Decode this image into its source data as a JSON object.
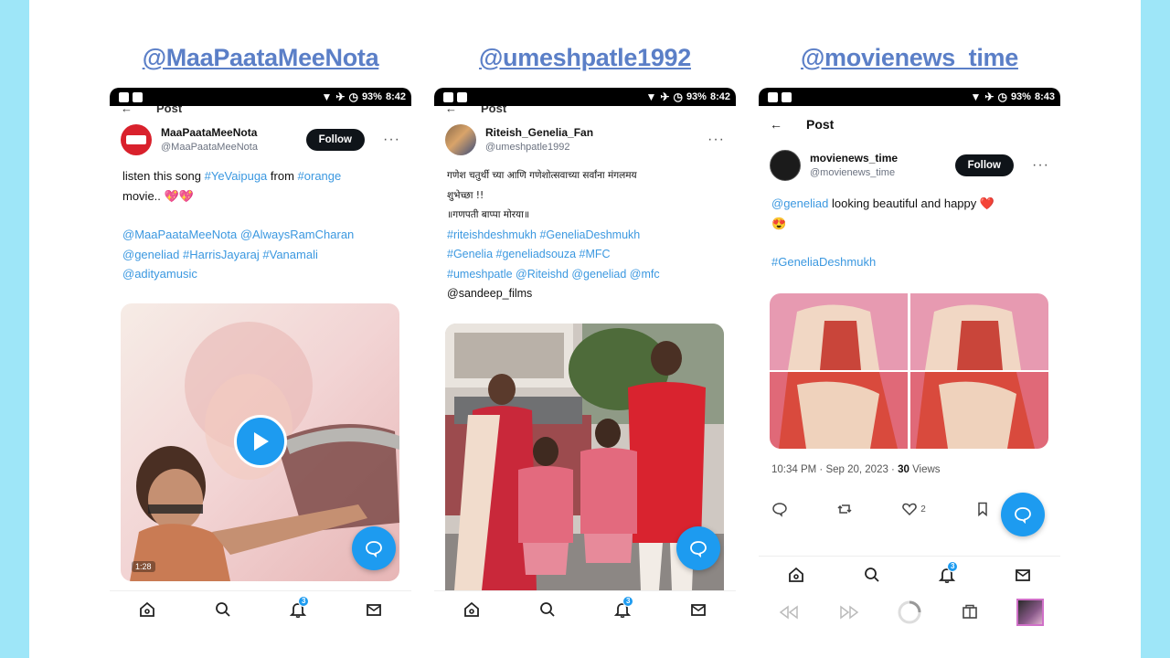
{
  "colors": {
    "link": "#5b7fc7",
    "hashtag": "#3b98e0",
    "accent": "#1d9bf0",
    "page_border": "#9ee6f8"
  },
  "status": {
    "battery": "93%",
    "time_1": "8:42",
    "time_2": "8:42",
    "time_3": "8:43"
  },
  "columns": [
    {
      "handle": "@MaaPaataMeeNota",
      "header_title": "Post",
      "author": {
        "display_name": "MaaPaataMeeNota",
        "username": "@MaaPaataMeeNota"
      },
      "follow_label": "Follow",
      "text_line1_a": "listen this song ",
      "text_line1_tag1": "#YeVaipuga",
      "text_line1_b": " from ",
      "text_line1_tag2": "#orange",
      "text_line2": "movie.. 💖💖",
      "mentions_line1": "@MaaPaataMeeNota  @AlwaysRamCharan",
      "mentions_line2": "@geneliad  #HarrisJayaraj #Vanamali",
      "mentions_line3": "@adityamusic",
      "video_duration": "1:28",
      "notification_count": "3"
    },
    {
      "handle": "@umeshpatle1992",
      "header_title": "Post",
      "author": {
        "display_name": "Riteish_Genelia_Fan",
        "username": "@umeshpatle1992"
      },
      "text_line1": "गणेश चतुर्थी च्या आणि गणेशोत्सवाच्या सर्वांना मंगलमय",
      "text_line2": "शुभेच्छा !!",
      "text_line3": "॥गणपती बाप्पा मोरया॥",
      "tags_line1": "#riteishdeshmukh #GeneliaDeshmukh",
      "tags_line2": "#Genelia #geneliadsouza #MFC",
      "tags_line3": "#umeshpatle @Riteishd @geneliad @mfc",
      "text_line7": "@sandeep_films",
      "notification_count": "3"
    },
    {
      "handle": "@movienews_time",
      "header_title": "Post",
      "author": {
        "display_name": "movienews_time",
        "username": "@movienews_time"
      },
      "follow_label": "Follow",
      "text_tag": "@geneliad",
      "text_rest": " looking beautiful and happy ❤️",
      "text_line2": "😍",
      "hashtag": "#GeneliaDeshmukh",
      "timestamp": "10:34 PM · Sep 20, 2023 · ",
      "views_count": "30",
      "views_label": " Views",
      "like_count": "2",
      "notification_count": "3"
    }
  ]
}
